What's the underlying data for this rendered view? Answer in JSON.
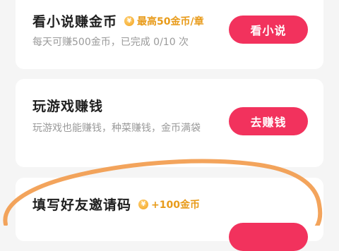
{
  "tasks": [
    {
      "title": "看小说赚金币",
      "badge": "最高50金币/章",
      "coin_glyph": "¥",
      "description": "每天可赚500金币，已完成 0/10 次",
      "button": "看小说"
    },
    {
      "title": "玩游戏赚钱",
      "description": "玩游戏也能赚钱，种菜赚钱，金币满袋",
      "button": "去赚钱"
    },
    {
      "title": "填写好友邀请码",
      "badge": "+100金币",
      "coin_glyph": "¥",
      "button": ""
    }
  ],
  "colors": {
    "accent": "#f2325d",
    "badge": "#e89b1a",
    "annotation": "#f29a4a"
  }
}
